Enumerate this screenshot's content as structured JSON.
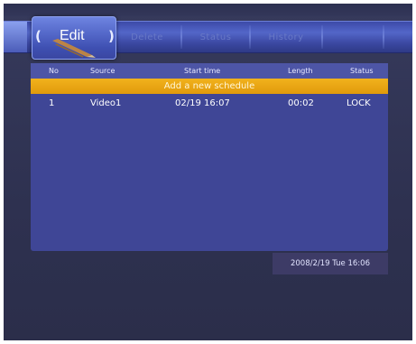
{
  "menu": {
    "tabs": [
      {
        "label": "Edit",
        "active": true
      },
      {
        "label": "Delete",
        "active": false
      },
      {
        "label": "Status",
        "active": false
      },
      {
        "label": "History",
        "active": false
      }
    ],
    "left_arrow": "(",
    "right_arrow": ")"
  },
  "schedule": {
    "columns": {
      "no": "No",
      "source": "Source",
      "start_time": "Start time",
      "length": "Length",
      "status": "Status"
    },
    "add_label": "Add a new schedule",
    "rows": [
      {
        "no": "1",
        "source": "Video1",
        "start_time": "02/19 16:07",
        "length": "00:02",
        "status": "LOCK"
      }
    ]
  },
  "clock": {
    "text": "2008/2/19 Tue 16:06"
  },
  "colors": {
    "menubar": "#4c5ec0",
    "panel": "#3f4696",
    "highlight": "#f0ae1a",
    "background": "#30334f"
  },
  "icons": {
    "edit_tab": "pencil-icon"
  }
}
